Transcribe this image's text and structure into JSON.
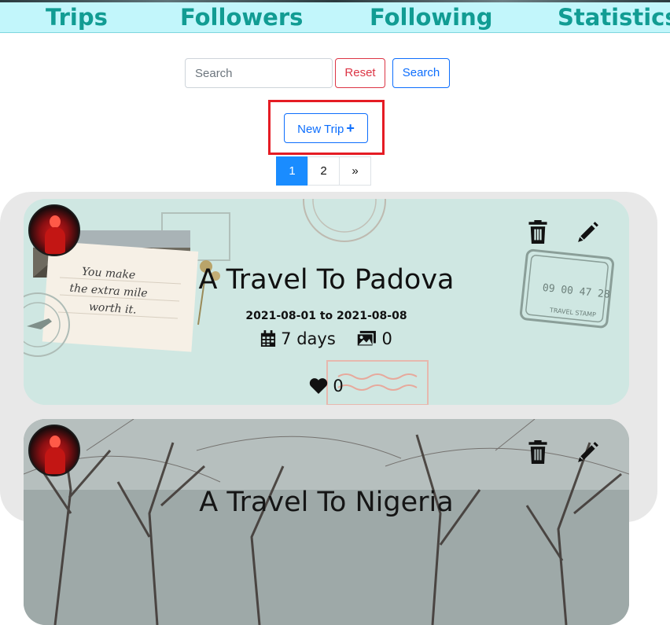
{
  "nav": {
    "trips": "Trips",
    "followers": "Followers",
    "following": "Following",
    "statistics": "Statistics"
  },
  "search": {
    "placeholder": "Search",
    "value": "",
    "reset_label": "Reset",
    "search_label": "Search"
  },
  "new_trip": {
    "label": "New Trip",
    "icon": "plus-icon"
  },
  "pagination": {
    "pages": [
      "1",
      "2"
    ],
    "active": "1",
    "next": "»"
  },
  "trips": [
    {
      "title": "A Travel To Padova",
      "dates": "2021-08-01 to 2021-08-08",
      "days": "7 days",
      "photos": "0",
      "likes": "0",
      "note_text": "You make the extra mile worth it.",
      "stamp_text": "09 00 47 28",
      "stamp_label": "TRAVEL STAMP"
    },
    {
      "title": "A Travel To Nigeria",
      "dates": "",
      "days": "",
      "photos": "",
      "likes": ""
    }
  ],
  "colors": {
    "nav_bg": "#c2f6fb",
    "nav_text": "#119c93",
    "primary": "#0d6efd",
    "danger": "#dc3545",
    "highlight": "#e51c24",
    "page_active": "#1a8cff"
  }
}
